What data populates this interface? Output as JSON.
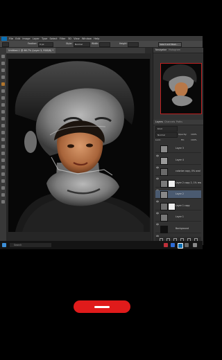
{
  "menubar": {
    "items": [
      "File",
      "Edit",
      "Image",
      "Layer",
      "Type",
      "Select",
      "Filter",
      "3D",
      "View",
      "Window",
      "Help"
    ]
  },
  "optionsbar": {
    "feather_label": "Feather:",
    "feather_value": "0 px",
    "style_label": "Style:",
    "style_value": "Normal",
    "width_label": "Width:",
    "height_label": "Height:",
    "select_mask_label": "Select and Mask..."
  },
  "document_tab": {
    "label": "Untitled-1 @ 66.7% (Layer 3, RGB/8) *"
  },
  "status": {
    "zoom": "66.67%",
    "doc": "Doc: 5.93M/44.5M"
  },
  "navigator": {
    "tabs": [
      "Navigator",
      "Histogram"
    ]
  },
  "layers_panel": {
    "tabs": [
      "Layers",
      "Channels",
      "Paths"
    ],
    "kind_label": "Kind",
    "blend_mode": "Normal",
    "opacity_label": "Opacity:",
    "opacity_value": "100%",
    "lock_label": "Lock:",
    "fill_label": "Fill:",
    "fill_value": "100%",
    "layers": [
      {
        "name": "Layer 3",
        "selected": false
      },
      {
        "name": "Layer 4",
        "selected": false
      },
      {
        "name": "colorize copy, 0% oval layer",
        "selected": false
      },
      {
        "name": "Layer 2 copy 2, 1% resolution",
        "selected": false
      },
      {
        "name": "Layer 2",
        "selected": true
      },
      {
        "name": "Layer 1 copy",
        "selected": false
      },
      {
        "name": "Layer 1",
        "selected": false
      },
      {
        "name": "Background",
        "selected": false
      }
    ]
  },
  "taskbar": {
    "search_placeholder": "Search"
  },
  "colors": {
    "accent_red": "#e01b1b",
    "ps_blue": "#0b6fb3",
    "selected_layer": "#4a5a70"
  }
}
